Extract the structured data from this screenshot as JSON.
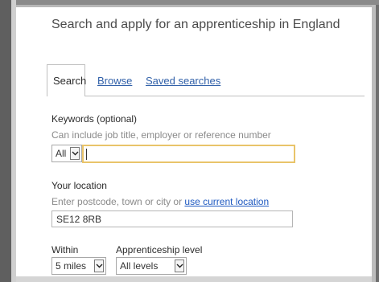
{
  "page_title": "Search and apply for an apprenticeship in England",
  "tabs": {
    "search": "Search",
    "browse": "Browse",
    "saved": "Saved searches"
  },
  "keywords": {
    "label": "Keywords (optional)",
    "hint": "Can include job title, employer or reference number",
    "category_value": "All",
    "value": ""
  },
  "location": {
    "label": "Your location",
    "hint_prefix": "Enter postcode, town or city or ",
    "hint_link": "use current location",
    "value": "SE12 8RB"
  },
  "within": {
    "label": "Within",
    "value": "5 miles"
  },
  "level": {
    "label": "Apprenticeship level",
    "value": "All levels"
  },
  "colors": {
    "link": "#2f5fa8",
    "focus_border": "#e9c46a"
  },
  "icons": [
    "chevron-down-icon"
  ]
}
